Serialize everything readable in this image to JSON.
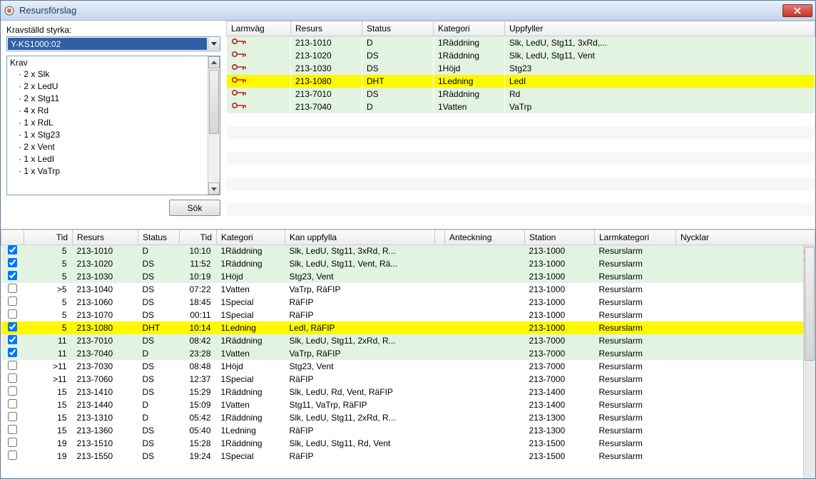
{
  "window": {
    "title": "Resursförslag"
  },
  "left": {
    "label": "Kravställd styrka:",
    "combo_value": "Y-KS1000:02",
    "krav_header": "Krav",
    "krav_items": [
      "2 x Slk",
      "2 x LedU",
      "2 x Stg11",
      "4 x Rd",
      "1 x RdL",
      "1 x Stg23",
      "2 x Vent",
      "1 x LedI",
      "1 x VaTrp"
    ],
    "sok": "Sök"
  },
  "top_table": {
    "headers": [
      "Larmväg",
      "Resurs",
      "Status",
      "Kategori",
      "Uppfyller"
    ],
    "rows": [
      {
        "cls": "row-g",
        "resurs": "213-1010",
        "status": "D",
        "kategori": "1Räddning",
        "uppfyller": "Slk, LedU, Stg11, 3xRd,..."
      },
      {
        "cls": "row-g",
        "resurs": "213-1020",
        "status": "DS",
        "kategori": "1Räddning",
        "uppfyller": "Slk, LedU, Stg11, Vent"
      },
      {
        "cls": "row-g",
        "resurs": "213-1030",
        "status": "DS",
        "kategori": "1Höjd",
        "uppfyller": "Stg23"
      },
      {
        "cls": "row-y",
        "resurs": "213-1080",
        "status": "DHT",
        "kategori": "1Ledning",
        "uppfyller": "LedI"
      },
      {
        "cls": "row-g",
        "resurs": "213-7010",
        "status": "DS",
        "kategori": "1Räddning",
        "uppfyller": "Rd"
      },
      {
        "cls": "row-g",
        "resurs": "213-7040",
        "status": "D",
        "kategori": "1Vatten",
        "uppfyller": "VaTrp"
      }
    ]
  },
  "bottom_table": {
    "headers": [
      "",
      "Tid",
      "Resurs",
      "Status",
      "Tid",
      "Kategori",
      "Kan uppfylla",
      "",
      "Anteckning",
      "Station",
      "Larmkategori",
      "Nycklar"
    ],
    "rows": [
      {
        "chk": true,
        "cls": "row-g",
        "tid1": "5",
        "resurs": "213-1010",
        "status": "D",
        "tid2": "10:10",
        "kat": "1Räddning",
        "kan": "Slk, LedU, Stg11, 3xRd, R...",
        "ant": "",
        "stn": "213-1000",
        "lk": "Resurslarm"
      },
      {
        "chk": true,
        "cls": "row-g",
        "tid1": "5",
        "resurs": "213-1020",
        "status": "DS",
        "tid2": "11:52",
        "kat": "1Räddning",
        "kan": "Slk, LedU, Stg11, Vent, Rä...",
        "ant": "",
        "stn": "213-1000",
        "lk": "Resurslarm"
      },
      {
        "chk": true,
        "cls": "row-g",
        "tid1": "5",
        "resurs": "213-1030",
        "status": "DS",
        "tid2": "10:19",
        "kat": "1Höjd",
        "kan": "Stg23, Vent",
        "ant": "",
        "stn": "213-1000",
        "lk": "Resurslarm"
      },
      {
        "chk": false,
        "cls": "row-w",
        "tid1": ">5",
        "resurs": "213-1040",
        "status": "DS",
        "tid2": "07:22",
        "kat": "1Vatten",
        "kan": "VaTrp, RäFIP",
        "ant": "",
        "stn": "213-1000",
        "lk": "Resurslarm"
      },
      {
        "chk": false,
        "cls": "row-w",
        "tid1": "5",
        "resurs": "213-1060",
        "status": "DS",
        "tid2": "18:45",
        "kat": "1Special",
        "kan": "RäFIP",
        "ant": "",
        "stn": "213-1000",
        "lk": "Resurslarm"
      },
      {
        "chk": false,
        "cls": "row-w",
        "tid1": "5",
        "resurs": "213-1070",
        "status": "DS",
        "tid2": "00:11",
        "kat": "1Special",
        "kan": "RäFIP",
        "ant": "",
        "stn": "213-1000",
        "lk": "Resurslarm"
      },
      {
        "chk": true,
        "cls": "row-y",
        "tid1": "5",
        "resurs": "213-1080",
        "status": "DHT",
        "tid2": "10:14",
        "kat": "1Ledning",
        "kan": "LedI, RäFIP",
        "ant": "",
        "stn": "213-1000",
        "lk": "Resurslarm"
      },
      {
        "chk": true,
        "cls": "row-g",
        "tid1": "11",
        "resurs": "213-7010",
        "status": "DS",
        "tid2": "08:42",
        "kat": "1Räddning",
        "kan": "Slk, LedU, Stg11, 2xRd, R...",
        "ant": "",
        "stn": "213-7000",
        "lk": "Resurslarm"
      },
      {
        "chk": true,
        "cls": "row-g",
        "tid1": "11",
        "resurs": "213-7040",
        "status": "D",
        "tid2": "23:28",
        "kat": "1Vatten",
        "kan": "VaTrp, RäFIP",
        "ant": "",
        "stn": "213-7000",
        "lk": "Resurslarm"
      },
      {
        "chk": false,
        "cls": "row-w",
        "tid1": ">11",
        "resurs": "213-7030",
        "status": "DS",
        "tid2": "08:48",
        "kat": "1Höjd",
        "kan": "Stg23, Vent",
        "ant": "",
        "stn": "213-7000",
        "lk": "Resurslarm"
      },
      {
        "chk": false,
        "cls": "row-w",
        "tid1": ">11",
        "resurs": "213-7060",
        "status": "DS",
        "tid2": "12:37",
        "kat": "1Special",
        "kan": "RäFIP",
        "ant": "",
        "stn": "213-7000",
        "lk": "Resurslarm"
      },
      {
        "chk": false,
        "cls": "row-w",
        "tid1": "15",
        "resurs": "213-1410",
        "status": "DS",
        "tid2": "15:29",
        "kat": "1Räddning",
        "kan": "Slk, LedU, Rd, Vent, RäFIP",
        "ant": "",
        "stn": "213-1400",
        "lk": "Resurslarm"
      },
      {
        "chk": false,
        "cls": "row-w",
        "tid1": "15",
        "resurs": "213-1440",
        "status": "D",
        "tid2": "15:09",
        "kat": "1Vatten",
        "kan": "Stg11, VaTrp, RäFIP",
        "ant": "",
        "stn": "213-1400",
        "lk": "Resurslarm"
      },
      {
        "chk": false,
        "cls": "row-w",
        "tid1": "15",
        "resurs": "213-1310",
        "status": "D",
        "tid2": "05:42",
        "kat": "1Räddning",
        "kan": "Slk, LedU, Stg11, 2xRd, R...",
        "ant": "",
        "stn": "213-1300",
        "lk": "Resurslarm"
      },
      {
        "chk": false,
        "cls": "row-w",
        "tid1": "15",
        "resurs": "213-1360",
        "status": "DS",
        "tid2": "05:40",
        "kat": "1Ledning",
        "kan": "RäFIP",
        "ant": "",
        "stn": "213-1300",
        "lk": "Resurslarm"
      },
      {
        "chk": false,
        "cls": "row-w",
        "tid1": "19",
        "resurs": "213-1510",
        "status": "DS",
        "tid2": "15:28",
        "kat": "1Räddning",
        "kan": "Slk, LedU, Stg11, Rd, Vent",
        "ant": "",
        "stn": "213-1500",
        "lk": "Resurslarm"
      },
      {
        "chk": false,
        "cls": "row-w",
        "tid1": "19",
        "resurs": "213-1550",
        "status": "DS",
        "tid2": "19:24",
        "kat": "1Special",
        "kan": "RäFIP",
        "ant": "",
        "stn": "213-1500",
        "lk": "Resurslarm"
      }
    ]
  }
}
